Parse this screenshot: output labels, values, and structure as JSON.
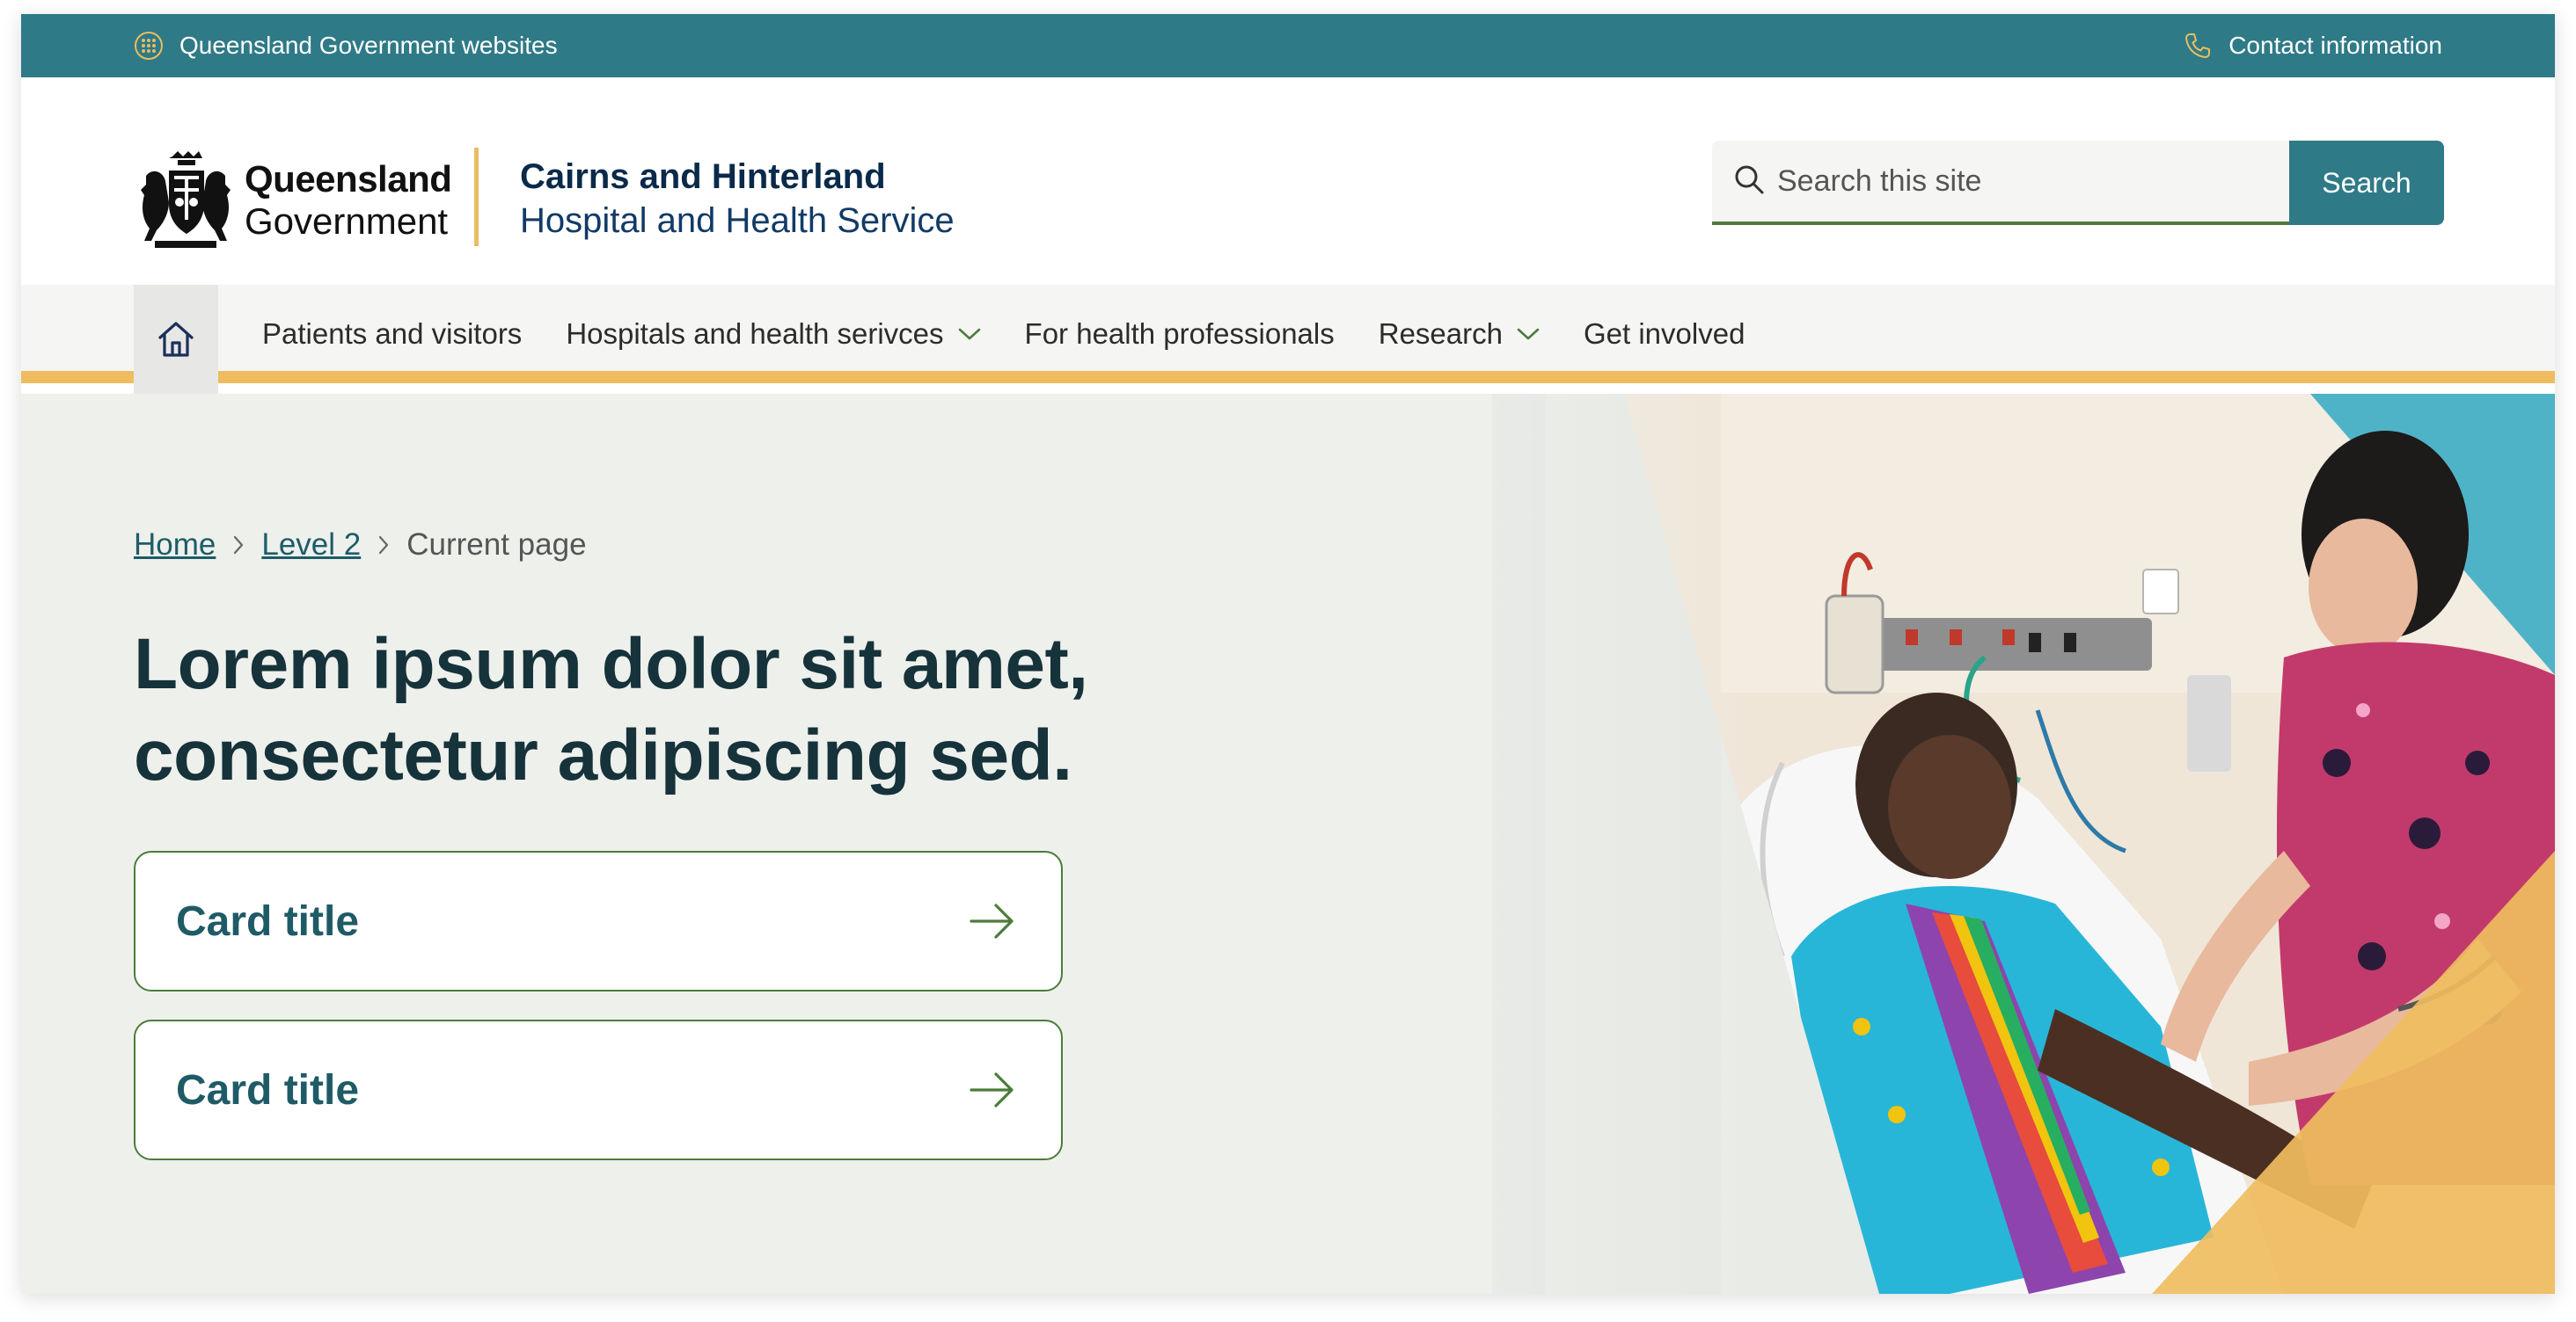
{
  "topbar": {
    "left_label": "Queensland Government websites",
    "right_label": "Contact information"
  },
  "logo": {
    "qg_line1": "Queensland",
    "qg_line2": "Government",
    "service_line1": "Cairns and Hinterland",
    "service_line2": "Hospital and Health Service"
  },
  "search": {
    "placeholder": "Search this site",
    "button_label": "Search"
  },
  "nav": {
    "items": [
      {
        "label": "Patients and visitors",
        "dropdown": false
      },
      {
        "label": "Hospitals and health serivces",
        "dropdown": true
      },
      {
        "label": "For health professionals",
        "dropdown": false
      },
      {
        "label": "Research",
        "dropdown": true
      },
      {
        "label": "Get involved",
        "dropdown": false
      }
    ]
  },
  "breadcrumb": {
    "home": "Home",
    "level2": "Level 2",
    "current": "Current page"
  },
  "hero": {
    "title": "Lorem ipsum dolor sit amet, consectetur adipiscing sed."
  },
  "cards": [
    {
      "title": "Card title"
    },
    {
      "title": "Card title"
    }
  ],
  "colors": {
    "teal": "#2f7a87",
    "gold": "#efbd60",
    "green": "#4b7c3b",
    "navy": "#0b2a4a"
  }
}
